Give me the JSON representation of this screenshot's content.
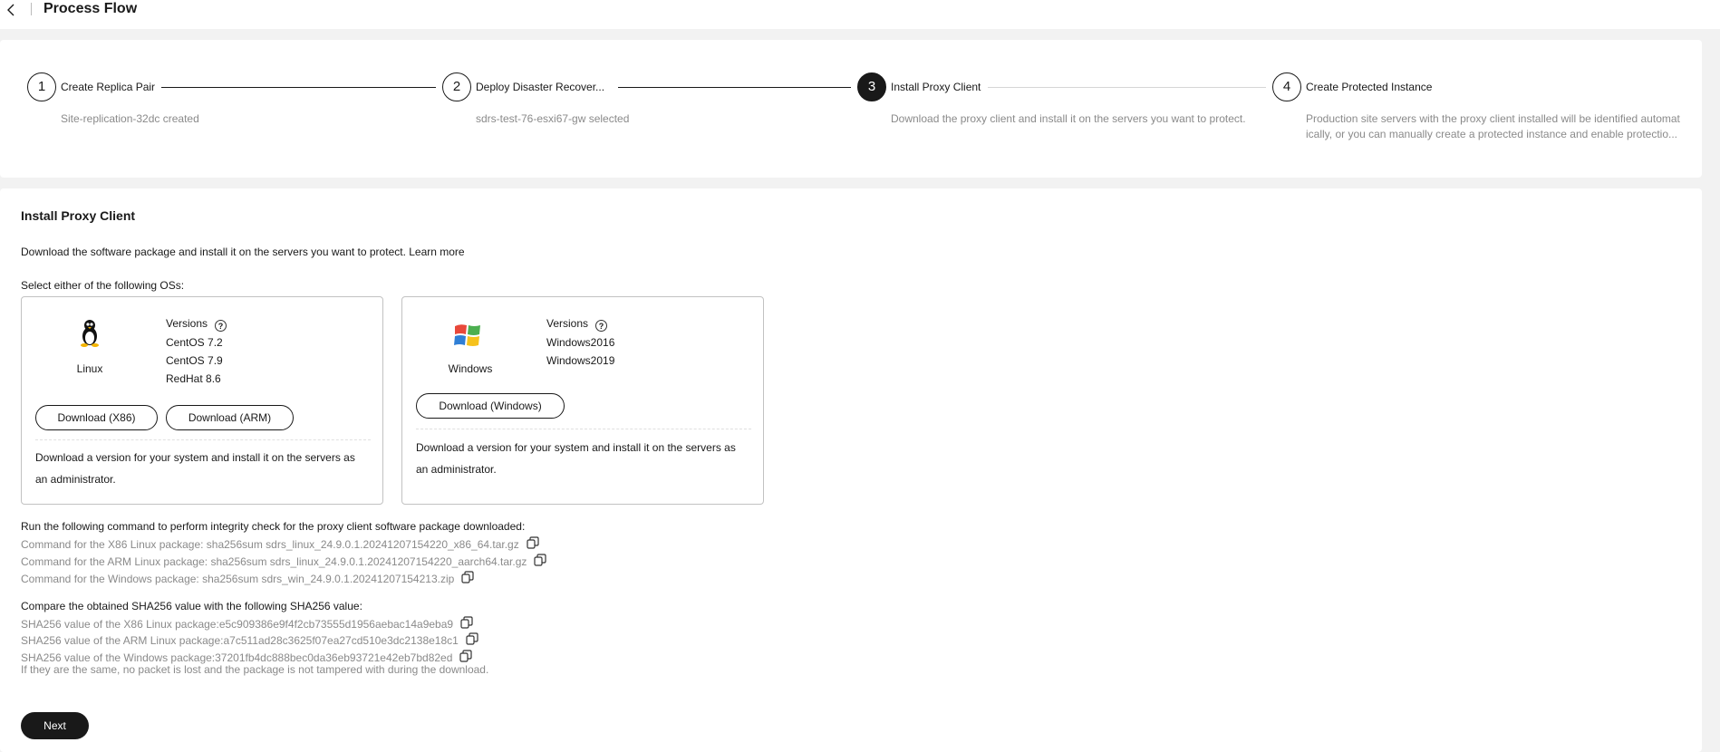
{
  "header": {
    "title": "Process Flow"
  },
  "steps": [
    {
      "num": "1",
      "label": "Create Replica Pair",
      "desc": "Site-replication-32dc created"
    },
    {
      "num": "2",
      "label": "Deploy Disaster Recover...",
      "desc": "sdrs-test-76-esxi67-gw selected"
    },
    {
      "num": "3",
      "label": "Install Proxy Client",
      "desc": "Download the proxy client and install it on the servers you want to protect."
    },
    {
      "num": "4",
      "label": "Create Protected Instance",
      "desc_line1": "Production site servers with the proxy client installed will be identified automat",
      "desc_line2": "ically, or you can manually create a protected instance and enable protectio..."
    }
  ],
  "main": {
    "heading": "Install Proxy Client",
    "intro": "Download the software package and install it on the servers you want to protect. Learn more",
    "select_text": "Select either of the following OSs:"
  },
  "linux": {
    "name": "Linux",
    "versions_title": "Versions",
    "versions": [
      "CentOS 7.2",
      "CentOS 7.9",
      "RedHat 8.6"
    ],
    "btn_x86": "Download (X86)",
    "btn_arm": "Download (ARM)",
    "note_line1": "Download a version for your system and install it on the servers as",
    "note_line2": "an administrator."
  },
  "windows": {
    "name": "Windows",
    "versions_title": "Versions",
    "versions": [
      "Windows2016",
      "Windows2019"
    ],
    "btn": "Download (Windows)",
    "note_line1": "Download a version for your system and install it on the servers as",
    "note_line2": "an administrator."
  },
  "commands": {
    "title": "Run the following command to perform integrity check for the proxy client software package downloaded:",
    "x86": "Command for the X86 Linux package: sha256sum sdrs_linux_24.9.0.1.20241207154220_x86_64.tar.gz",
    "arm": "Command for the ARM Linux package: sha256sum sdrs_linux_24.9.0.1.20241207154220_aarch64.tar.gz",
    "win": "Command for the Windows package: sha256sum sdrs_win_24.9.0.1.20241207154213.zip"
  },
  "sha": {
    "title": "Compare the obtained SHA256 value with the following SHA256 value:",
    "x86": "SHA256 value of the X86 Linux package:e5c909386e9f4f2cb73555d1956aebac14a9eba9",
    "arm": "SHA256 value of the ARM Linux package:a7c511ad28c3625f07ea27cd510e3dc2138e18c1",
    "win": "SHA256 value of the Windows package:37201fb4dc888bec0da36eb93721e42eb7bd82ed",
    "note": "If they are the same, no packet is lost and the package is not tampered with during the download."
  },
  "next_label": "Next"
}
